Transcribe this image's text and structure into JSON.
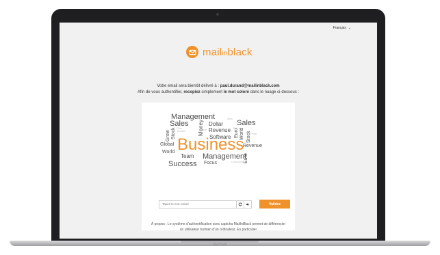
{
  "device": {
    "brand_label": "MacBook"
  },
  "header": {
    "language": "Français"
  },
  "logo": {
    "text_main": "mail",
    "text_in": "in",
    "text_end": "black",
    "color": "#f0922b"
  },
  "message": {
    "line1_pre": "Votre email sera bientôt délivré à : ",
    "email": "paul.durand@mailinblack.com",
    "line2_pre": "Afin de vous authentifier, ",
    "recopiez": "recopiez",
    "line2_mid": " simplement ",
    "mot_colore": "le mot coloré",
    "line2_post": " dans le nuage ci-dessous :"
  },
  "word_cloud": [
    {
      "text": "Management",
      "size": 11
    },
    {
      "text": "Sales",
      "size": 11
    },
    {
      "text": "Dollar",
      "size": 8
    },
    {
      "text": "Sales",
      "size": 11
    },
    {
      "text": "Revenue",
      "size": 8
    },
    {
      "text": "Software",
      "size": 8
    },
    {
      "text": "Business",
      "size": 24,
      "highlight": true
    },
    {
      "text": "Revenue",
      "size": 7
    },
    {
      "text": "Global",
      "size": 7
    },
    {
      "text": "World",
      "size": 7
    },
    {
      "text": "Team",
      "size": 8
    },
    {
      "text": "Management",
      "size": 11
    },
    {
      "text": "Success",
      "size": 11
    },
    {
      "text": "Focus",
      "size": 7
    },
    {
      "text": "Grow",
      "size": 7
    },
    {
      "text": "Stock",
      "size": 7
    },
    {
      "text": "Money",
      "size": 8
    },
    {
      "text": "Euro",
      "size": 7
    },
    {
      "text": "World",
      "size": 7
    },
    {
      "text": "Stock",
      "size": 7
    },
    {
      "text": "Euro",
      "size": 7
    },
    {
      "text": "Plan",
      "size": 4
    },
    {
      "text": "Plan",
      "size": 4
    },
    {
      "text": "Idea",
      "size": 4
    },
    {
      "text": "Sell",
      "size": 4
    },
    {
      "text": "Consulting",
      "size": 4
    },
    {
      "text": "Trade",
      "size": 4
    },
    {
      "text": "Market",
      "size": 4
    },
    {
      "text": "Profit",
      "size": 4
    }
  ],
  "form": {
    "input_placeholder": "Tapez le mot coloré",
    "refresh_icon": "refresh-icon",
    "audio_icon": "speaker-icon",
    "validate_label": "Validez"
  },
  "about": {
    "line1": "À propos : Le système d'authentification avec captcha MailInBlack permet de différencier",
    "line2": "un utilisateur humain d'un ordinateur. En particulier"
  }
}
